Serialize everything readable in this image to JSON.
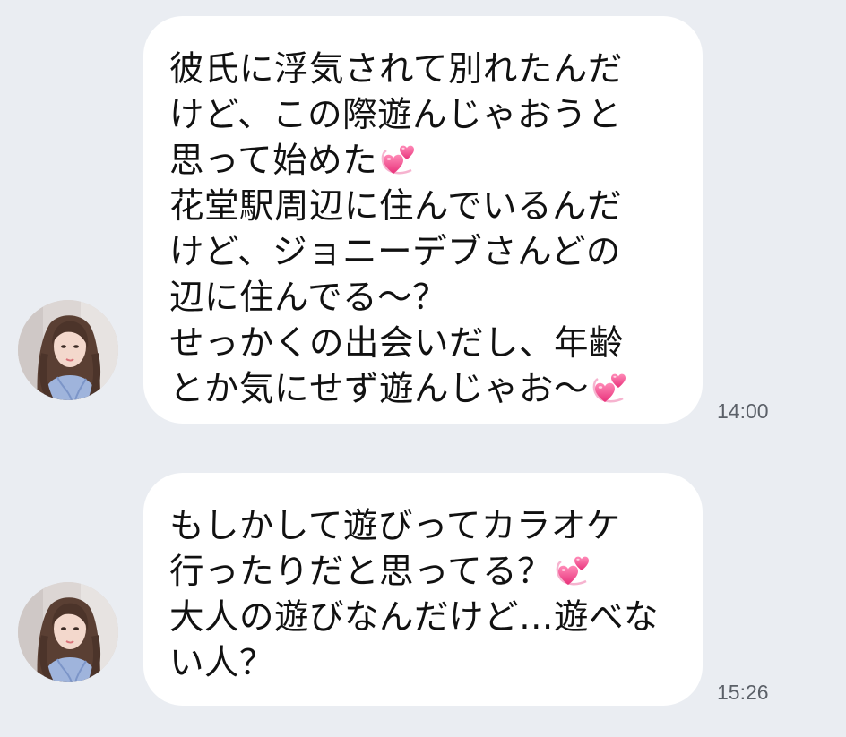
{
  "chat": {
    "messages": [
      {
        "sender": "incoming",
        "lines": [
          "彼氏に浮気されて別れたんだ",
          "けど、この際遊んじゃおうと",
          "思って始めた",
          "花堂駅周辺に住んでいるんだ",
          "けど、ジョニーデブさんどの",
          "辺に住んでる～？",
          "せっかくの出会いだし、年齢",
          "とか気にせず遊んじゃお～"
        ],
        "time": "14:00"
      },
      {
        "sender": "incoming",
        "lines": [
          "もしかして遊びってカラオケ",
          "行ったりだと思ってる？",
          "大人の遊びなんだけど…遊べな",
          "い人？"
        ],
        "time": "15:26"
      }
    ]
  },
  "icons": {
    "avatar": "avatar-photo",
    "emoji": "two-hearts-icon"
  },
  "colors": {
    "background": "#eaedf2",
    "bubble": "#ffffff",
    "text": "#111111",
    "timestamp": "#5b6068",
    "heart": "#f0508c"
  }
}
